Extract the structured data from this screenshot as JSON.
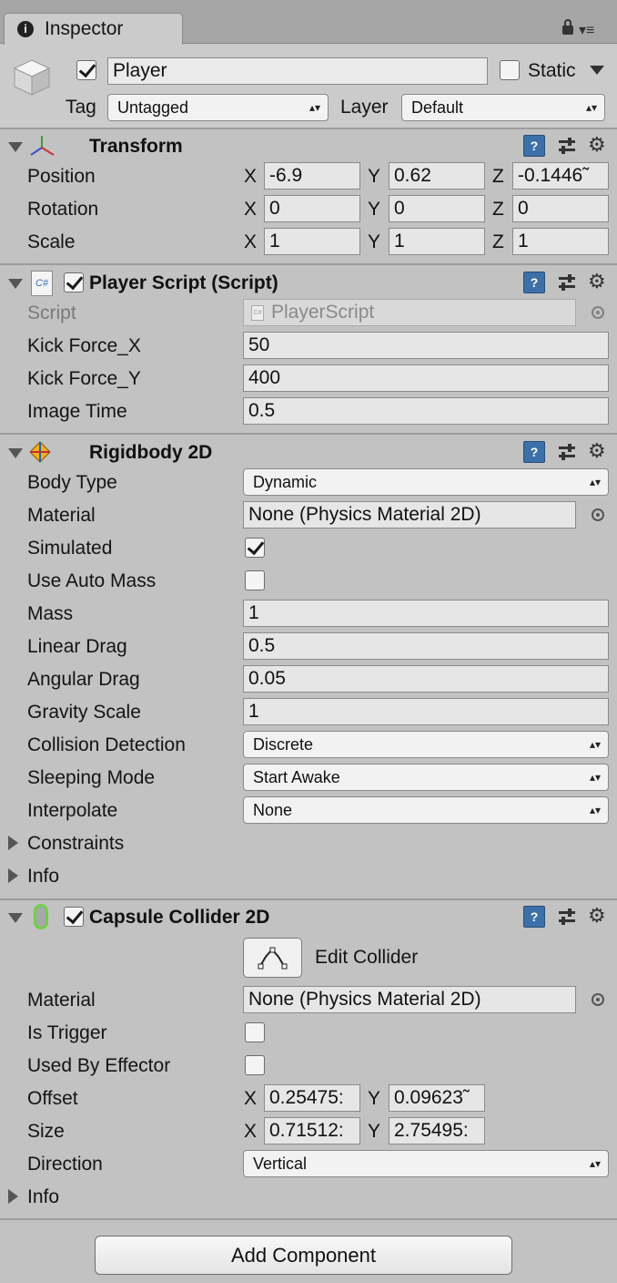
{
  "tab": {
    "title": "Inspector"
  },
  "object": {
    "active": true,
    "name": "Player",
    "static_label": "Static",
    "tag_label": "Tag",
    "tag_value": "Untagged",
    "layer_label": "Layer",
    "layer_value": "Default"
  },
  "transform": {
    "title": "Transform",
    "position": {
      "label": "Position",
      "x": "-6.9",
      "y": "0.62",
      "z": "-0.1446̃"
    },
    "rotation": {
      "label": "Rotation",
      "x": "0",
      "y": "0",
      "z": "0"
    },
    "scale": {
      "label": "Scale",
      "x": "1",
      "y": "1",
      "z": "1"
    },
    "axis_x": "X",
    "axis_y": "Y",
    "axis_z": "Z"
  },
  "player_script": {
    "title": "Player Script (Script)",
    "enabled": true,
    "script_label": "Script",
    "script_value": "PlayerScript",
    "kick_x_label": "Kick Force_X",
    "kick_x": "50",
    "kick_y_label": "Kick Force_Y",
    "kick_y": "400",
    "image_time_label": "Image Time",
    "image_time": "0.5"
  },
  "rigidbody": {
    "title": "Rigidbody 2D",
    "body_type_label": "Body Type",
    "body_type": "Dynamic",
    "material_label": "Material",
    "material": "None (Physics Material 2D)",
    "simulated_label": "Simulated",
    "simulated": true,
    "auto_mass_label": "Use Auto Mass",
    "auto_mass": false,
    "mass_label": "Mass",
    "mass": "1",
    "linear_drag_label": "Linear Drag",
    "linear_drag": "0.5",
    "angular_drag_label": "Angular Drag",
    "angular_drag": "0.05",
    "gravity_label": "Gravity Scale",
    "gravity": "1",
    "collision_label": "Collision Detection",
    "collision": "Discrete",
    "sleeping_label": "Sleeping Mode",
    "sleeping": "Start Awake",
    "interpolate_label": "Interpolate",
    "interpolate": "None",
    "constraints_label": "Constraints",
    "info_label": "Info"
  },
  "capsule": {
    "title": "Capsule Collider 2D",
    "enabled": true,
    "edit_label": "Edit Collider",
    "material_label": "Material",
    "material": "None (Physics Material 2D)",
    "trigger_label": "Is Trigger",
    "trigger": false,
    "effector_label": "Used By Effector",
    "effector": false,
    "offset_label": "Offset",
    "offset_x": "0.25475:",
    "offset_y": "0.09623̃",
    "size_label": "Size",
    "size_x": "0.71512:",
    "size_y": "2.75495:",
    "direction_label": "Direction",
    "direction": "Vertical",
    "info_label": "Info"
  },
  "add_component_label": "Add Component",
  "icons": {
    "help": "help-book-icon",
    "preset": "preset-sliders-icon",
    "gear": "gear-icon"
  }
}
